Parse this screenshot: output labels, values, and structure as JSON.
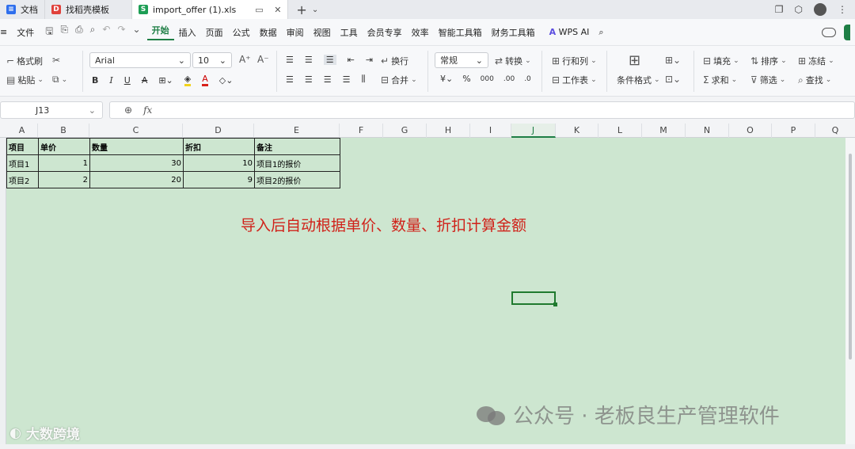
{
  "tabs": [
    {
      "label": "文档",
      "icon": "doc-icon",
      "color": "#2f6fed"
    },
    {
      "label": "找稻壳模板",
      "icon": "docer-icon",
      "color": "#e0413b"
    },
    {
      "label": "import_offer (1).xls",
      "icon": "sheet-icon",
      "color": "#1e9e55",
      "active": true
    }
  ],
  "menu": {
    "file": "文件",
    "items": [
      "开始",
      "插入",
      "页面",
      "公式",
      "数据",
      "审阅",
      "视图",
      "工具",
      "会员专享",
      "效率",
      "智能工具箱",
      "财务工具箱"
    ],
    "active": "开始",
    "wps_ai": "WPS AI"
  },
  "ribbon": {
    "format_painter": "格式刷",
    "paste": "粘贴",
    "font_name": "Arial",
    "font_size": "10",
    "wrap": "换行",
    "merge": "合并",
    "number_format": "常规",
    "convert": "转换",
    "row_col": "行和列",
    "worksheet": "工作表",
    "cond_format": "条件格式",
    "fill": "填充",
    "sort": "排序",
    "freeze": "冻结",
    "sum": "求和",
    "filter": "筛选",
    "find": "查找"
  },
  "formula_bar": {
    "cell_ref": "J13",
    "fx": "fx",
    "content": ""
  },
  "columns": [
    "A",
    "B",
    "C",
    "D",
    "E",
    "F",
    "G",
    "H",
    "I",
    "J",
    "K",
    "L",
    "M",
    "N",
    "O",
    "P",
    "Q"
  ],
  "selected_column": "J",
  "table": {
    "headers": [
      "项目",
      "单价",
      "数量",
      "折扣",
      "备注"
    ],
    "rows": [
      [
        "项目1",
        "1",
        "30",
        "10",
        "项目1的报价"
      ],
      [
        "项目2",
        "2",
        "20",
        "9",
        "项目2的报价"
      ]
    ]
  },
  "annotation": "导入后自动根据单价、数量、折扣计算金额",
  "watermark_left": "大数跨境",
  "watermark_right": "公众号 · 老板良生产管理软件"
}
